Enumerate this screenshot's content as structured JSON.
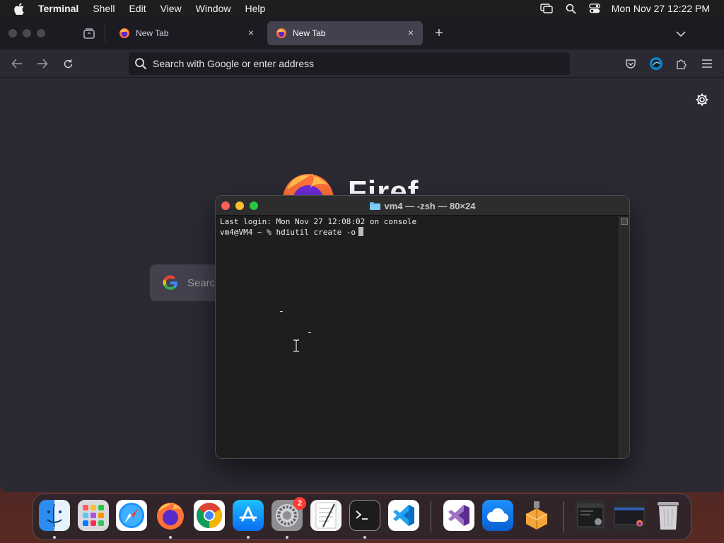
{
  "menubar": {
    "app_name": "Terminal",
    "items": [
      "Shell",
      "Edit",
      "View",
      "Window",
      "Help"
    ],
    "clock": "Mon Nov 27  12:22 PM"
  },
  "firefox": {
    "tabs": [
      {
        "title": "New Tab",
        "active": false
      },
      {
        "title": "New Tab",
        "active": true
      }
    ],
    "address_placeholder": "Search with Google or enter address",
    "newtab_search_placeholder": "Searc",
    "wordmark": "Firef"
  },
  "terminal": {
    "title": "vm4 — -zsh — 80×24",
    "lines": [
      "Last login: Mon Nov 27 12:08:02 on console",
      "vm4@VM4 ~ % hdiutil create -o"
    ]
  },
  "dock": {
    "apps": [
      {
        "name": "Finder",
        "icon": "finder-icon",
        "running": true
      },
      {
        "name": "Launchpad",
        "icon": "launchpad-icon",
        "running": false
      },
      {
        "name": "Safari",
        "icon": "safari-icon",
        "running": false
      },
      {
        "name": "Firefox",
        "icon": "firefox-icon",
        "running": true
      },
      {
        "name": "Google Chrome",
        "icon": "chrome-icon",
        "running": false
      },
      {
        "name": "App Store",
        "icon": "app-store-icon",
        "running": false
      },
      {
        "name": "System Settings",
        "icon": "settings-icon",
        "running": true,
        "badge": "2"
      },
      {
        "name": "TextEdit",
        "icon": "textedit-icon",
        "running": false
      },
      {
        "name": "Terminal",
        "icon": "terminal-icon",
        "running": true
      },
      {
        "name": "Visual Studio Code",
        "icon": "vscode-icon",
        "running": false
      },
      {
        "name": "Visual Studio",
        "icon": "visual-studio-icon",
        "running": false
      },
      {
        "name": "iCloud Drive",
        "icon": "icloud-icon",
        "running": false
      },
      {
        "name": "Installer",
        "icon": "installer-icon",
        "running": false
      },
      {
        "name": "Recent Window",
        "icon": "window-thumbnail-icon",
        "running": false
      },
      {
        "name": "Firefox Window",
        "icon": "window-thumbnail-icon",
        "running": false
      },
      {
        "name": "Trash",
        "icon": "trash-icon",
        "running": false
      }
    ]
  }
}
